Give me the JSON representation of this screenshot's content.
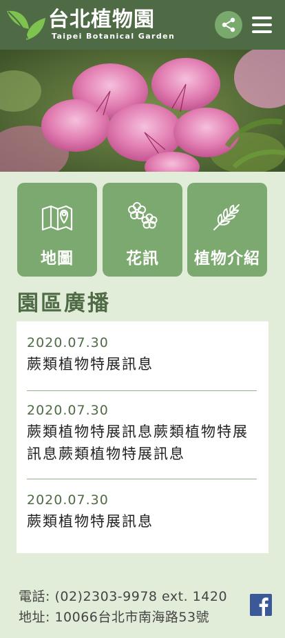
{
  "header": {
    "title": "台北植物園",
    "subtitle": "Taipei Botanical Garden"
  },
  "icons": {
    "share": "share-icon",
    "menu": "menu-icon",
    "map": "map-icon",
    "flower": "flower-icon",
    "plant": "plant-icon",
    "facebook": "facebook-icon"
  },
  "tiles": [
    {
      "label": "地圖"
    },
    {
      "label": "花訊"
    },
    {
      "label": "植物介紹"
    }
  ],
  "section": {
    "title": "園區廣播"
  },
  "news": [
    {
      "date": "2020.07.30",
      "text": "蕨類植物特展訊息"
    },
    {
      "date": "2020.07.30",
      "text": "蕨類植物特展訊息蕨類植物特展訊息蕨類植物特展訊息"
    },
    {
      "date": "2020.07.30",
      "text": "蕨類植物特展訊息"
    }
  ],
  "footer": {
    "phone": "電話: (02)2303-9978 ext. 1420",
    "address": "地址: 10066台北市南海路53號"
  },
  "colors": {
    "header_bg": "#4f6b45",
    "tile_bg": "#7ba96f",
    "page_bg": "#e2edd9"
  }
}
